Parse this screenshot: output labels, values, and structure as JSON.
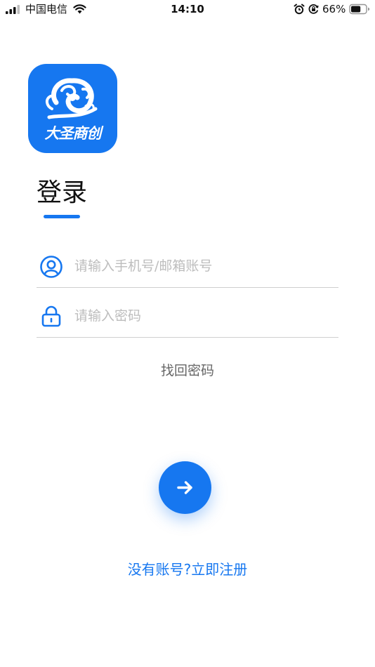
{
  "status_bar": {
    "carrier": "中国电信",
    "time": "14:10",
    "battery_percent": "66%",
    "battery_level": 0.66,
    "icons": [
      "signal-icon",
      "wifi-icon",
      "alarm-icon",
      "rotation-lock-icon",
      "battery-icon"
    ]
  },
  "logo": {
    "text": "大圣商创",
    "color": "#1677f0"
  },
  "login": {
    "title": "登录",
    "account_placeholder": "请输入手机号/邮箱账号",
    "password_placeholder": "请输入密码",
    "forgot_password": "找回密码",
    "submit_icon": "arrow-right-icon",
    "register_link": "没有账号?立即注册"
  },
  "colors": {
    "accent": "#1677f0",
    "placeholder": "#bdbdbd",
    "divider": "#cfcfcf",
    "secondary_text": "#666666"
  }
}
